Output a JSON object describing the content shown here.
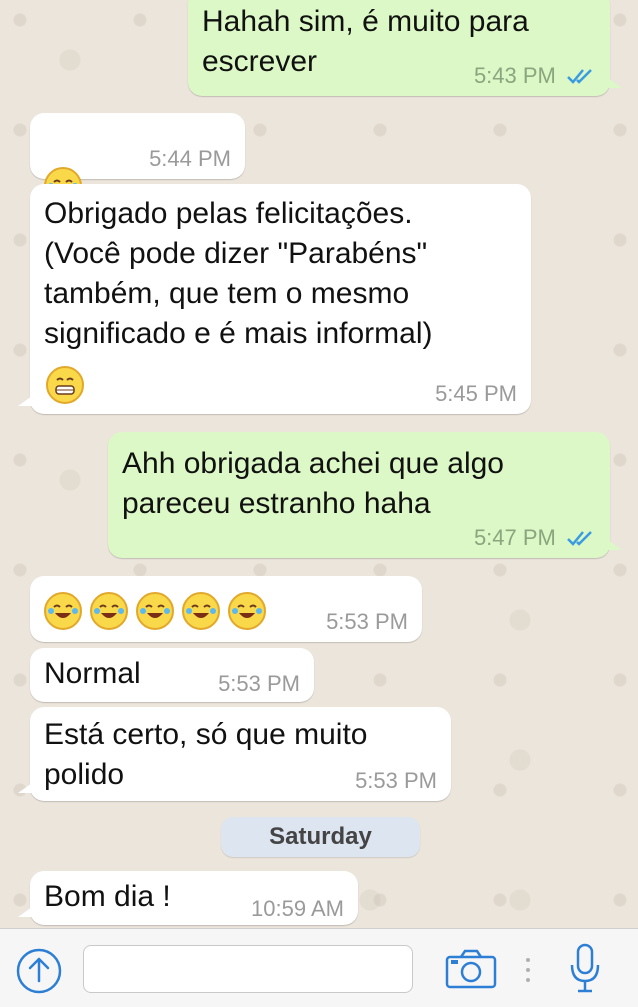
{
  "messages": [
    {
      "dir": "out",
      "text": "Hahah sim, é muito para\nescrever",
      "time": "5:43 PM",
      "read": true
    },
    {
      "dir": "in",
      "emoji": [
        "tears-of-joy"
      ],
      "time": "5:44 PM"
    },
    {
      "dir": "in",
      "text": "Obrigado pelas felicitações.\n(Você pode dizer \"Parabéns\"\ntambém, que tem o mesmo\nsignificado e é mais informal)",
      "emoji_after": [
        "grimacing"
      ],
      "time": "5:45 PM"
    },
    {
      "dir": "out",
      "text": "Ahh obrigada achei que algo\npareceu estranho haha",
      "time": "5:47 PM",
      "read": true
    },
    {
      "dir": "in",
      "emoji": [
        "tears-of-joy",
        "tears-of-joy",
        "tears-of-joy",
        "tears-of-joy",
        "tears-of-joy"
      ],
      "time": "5:53 PM"
    },
    {
      "dir": "in",
      "text": "Normal",
      "time": "5:53 PM"
    },
    {
      "dir": "in",
      "text": "Está certo, só que muito\npolido",
      "time": "5:53 PM"
    },
    {
      "dir": "in",
      "text": "Bom dia !",
      "time": "10:59 AM"
    }
  ],
  "day_separator": "Saturday",
  "input": {
    "placeholder": "",
    "value": ""
  },
  "icons": {
    "share": "upload-icon",
    "camera": "camera-icon",
    "more": "more-dots-icon",
    "mic": "microphone-icon"
  },
  "colors": {
    "accent": "#2d7fd5",
    "outgoing": "#dcf8c6",
    "incoming": "#ffffff",
    "read_ticks": "#3a9be0"
  }
}
